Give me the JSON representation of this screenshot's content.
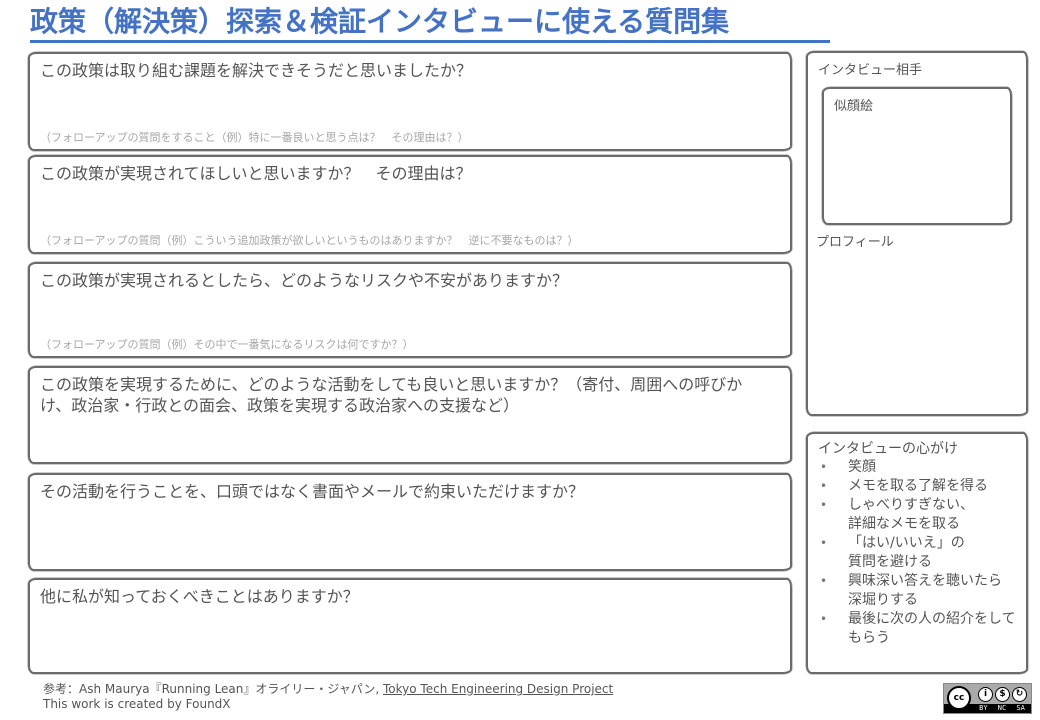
{
  "header": {
    "title": "政策（解決策）探索＆検証インタビューに使える質問集",
    "accent_color": "#4472c4"
  },
  "questions": [
    {
      "text": "この政策は取り組む課題を解決できそうだと思いましたか？",
      "hint": "（フォローアップの質問をすること（例）特に一番良いと思う点は？　その理由は？）"
    },
    {
      "text": "この政策が実現されてほしいと思いますか？　その理由は？",
      "hint": "（フォローアップの質問（例）こういう追加政策が欲しいというものはありますか？　逆に不要なものは？）"
    },
    {
      "text": "この政策が実現されるとしたら、どのようなリスクや不安がありますか？",
      "hint": "（フォローアップの質問（例）その中で一番気になるリスクは何ですか？）"
    },
    {
      "text": "この政策を実現するために、どのような活動をしても良いと思いますか？（寄付、周囲への呼びかけ、政治家・行政との面会、政策を実現する政治家への支援など）",
      "hint": ""
    },
    {
      "text": "その活動を行うことを、口頭ではなく書面やメールで約束いただけますか？",
      "hint": ""
    },
    {
      "text": "他に私が知っておくべきことはありますか？",
      "hint": ""
    }
  ],
  "interviewee": {
    "title": "インタビュー相手",
    "portrait_label": "似顔絵",
    "profile_label": "プロフィール"
  },
  "tips": {
    "title": "インタビューの心がけ",
    "bullet": "•",
    "items": [
      "笑顔",
      "メモを取る了解を得る",
      "しゃべりすぎない、\n詳細なメモを取る",
      "「はい/いいえ」の\n質問を避ける",
      "興味深い答えを聴いたら\n深堀りする",
      "最後に次の人の紹介をしてもらう"
    ]
  },
  "footer": {
    "reference_prefix": "参考：Ash Maurya『Running Lean』オライリー・ジャパン, ",
    "reference_link": "Tokyo Tech Engineering Design Project",
    "credit": "This work is created by FoundX"
  },
  "license": {
    "cc": "cc",
    "by": "BY",
    "nc": "NC",
    "sa": "SA",
    "by_icon": "i",
    "nc_icon": "$",
    "sa_icon": "↻"
  }
}
